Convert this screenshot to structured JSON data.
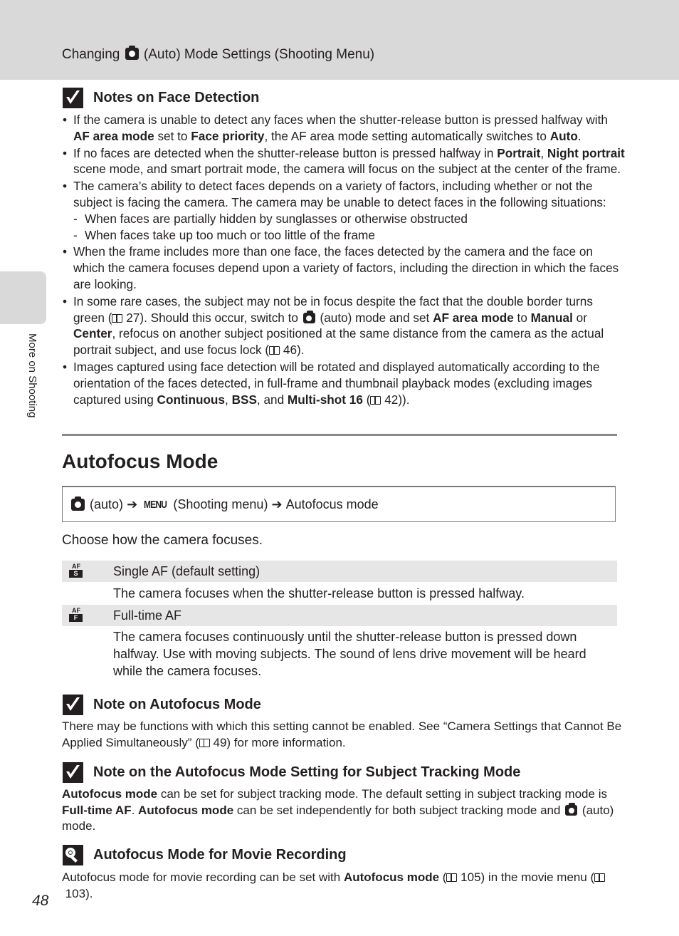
{
  "header": {
    "title_before": "Changing",
    "title_icon": "camera-auto-icon",
    "title_after": "(Auto) Mode Settings (Shooting Menu)"
  },
  "side_tab": {
    "label": "More on Shooting"
  },
  "notes_face_detection": {
    "icon": "check-note-icon",
    "title": "Notes on Face Detection",
    "bullets": [
      {
        "parts": [
          {
            "t": "If the camera is unable to detect any faces when the shutter-release button is pressed halfway with ",
            "b": false
          },
          {
            "t": "AF area mode",
            "b": true
          },
          {
            "t": " set to ",
            "b": false
          },
          {
            "t": "Face priority",
            "b": true
          },
          {
            "t": ", the AF area mode setting automatically switches to ",
            "b": false
          },
          {
            "t": "Auto",
            "b": true
          },
          {
            "t": ".",
            "b": false
          }
        ]
      },
      {
        "parts": [
          {
            "t": "If no faces are detected when the shutter-release button is pressed halfway in ",
            "b": false
          },
          {
            "t": "Portrait",
            "b": true
          },
          {
            "t": ", ",
            "b": false
          },
          {
            "t": "Night portrait",
            "b": true
          },
          {
            "t": " scene mode, and smart portrait mode, the camera will focus on the subject at the center of the frame.",
            "b": false
          }
        ]
      },
      {
        "parts": [
          {
            "t": "The camera’s ability to detect faces depends on a variety of factors, including whether or not the subject is facing the camera. The camera may be unable to detect faces in the following situations:",
            "b": false
          }
        ],
        "sub": [
          "When faces are partially hidden by sunglasses or otherwise obstructed",
          "When faces take up too much or too little of the frame"
        ]
      },
      {
        "parts": [
          {
            "t": "When the frame includes more than one face, the faces detected by the camera and the face on which the camera focuses depend upon a variety of factors, including the direction in which the faces are looking.",
            "b": false
          }
        ]
      },
      {
        "parts": [
          {
            "t": "In some rare cases, the subject may not be in focus despite the fact that the double border turns green (",
            "b": false
          },
          {
            "ref": "27"
          },
          {
            "t": "). Should this occur, switch to ",
            "b": false
          },
          {
            "cam": true
          },
          {
            "t": " (auto) mode and set ",
            "b": false
          },
          {
            "t": "AF area mode",
            "b": true
          },
          {
            "t": " to ",
            "b": false
          },
          {
            "t": "Manual",
            "b": true
          },
          {
            "t": " or ",
            "b": false
          },
          {
            "t": "Center",
            "b": true
          },
          {
            "t": ", refocus on another subject positioned at the same distance from the camera as the actual portrait subject, and use focus lock (",
            "b": false
          },
          {
            "ref": "46"
          },
          {
            "t": ").",
            "b": false
          }
        ]
      },
      {
        "parts": [
          {
            "t": "Images captured using face detection will be rotated and displayed automatically according to the orientation of the faces detected, in full-frame and thumbnail playback modes (excluding images captured using ",
            "b": false
          },
          {
            "t": "Continuous",
            "b": true
          },
          {
            "t": ", ",
            "b": false
          },
          {
            "t": "BSS",
            "b": true
          },
          {
            "t": ", and ",
            "b": false
          },
          {
            "t": "Multi-shot 16",
            "b": true
          },
          {
            "t": " (",
            "b": false
          },
          {
            "ref": "42"
          },
          {
            "t": ")).",
            "b": false
          }
        ]
      }
    ]
  },
  "section": {
    "title": "Autofocus Mode",
    "path": {
      "mode_label": "(auto)",
      "arrow": "➔",
      "menu_glyph": "MENU",
      "menu_label": "(Shooting menu)",
      "item": "Autofocus mode"
    },
    "intro": "Choose how the camera focuses.",
    "options": [
      {
        "icon": "af-s-icon",
        "icon_top": "AF",
        "icon_bottom": "S",
        "label": "Single AF (default setting)",
        "description": "The camera focuses when the shutter-release button is pressed halfway."
      },
      {
        "icon": "af-f-icon",
        "icon_top": "AF",
        "icon_bottom": "F",
        "label": "Full-time AF",
        "description": "The camera focuses continuously until the shutter-release button is pressed down halfway. Use with moving subjects. The sound of lens drive movement will be heard while the camera focuses."
      }
    ]
  },
  "note_autofocus": {
    "title": "Note on Autofocus Mode",
    "text_before": "There may be functions with which this setting cannot be enabled. See “Camera Settings that Cannot Be Applied Simultaneously” (",
    "ref": "49",
    "text_after": ") for more information."
  },
  "note_tracking": {
    "title": "Note on the Autofocus Mode Setting for Subject Tracking Mode",
    "parts": [
      {
        "t": "Autofocus mode",
        "b": true
      },
      {
        "t": " can be set for subject tracking mode. The default setting in subject tracking mode is ",
        "b": false
      },
      {
        "t": "Full-time AF",
        "b": true
      },
      {
        "t": ". ",
        "b": false
      },
      {
        "t": "Autofocus mode",
        "b": true
      },
      {
        "t": " can be set independently for both subject tracking mode and ",
        "b": false
      },
      {
        "cam": true
      },
      {
        "t": " (auto) mode.",
        "b": false
      }
    ]
  },
  "tip_movie": {
    "icon": "tip-bulb-icon",
    "title": "Autofocus Mode for Movie Recording",
    "parts": [
      {
        "t": "Autofocus mode for movie recording can be set with ",
        "b": false
      },
      {
        "t": "Autofocus mode",
        "b": true
      },
      {
        "t": " (",
        "b": false
      },
      {
        "ref": "105"
      },
      {
        "t": ") in the movie menu (",
        "b": false
      },
      {
        "ref": "103"
      },
      {
        "t": ").",
        "b": false
      }
    ]
  },
  "page_number": "48"
}
